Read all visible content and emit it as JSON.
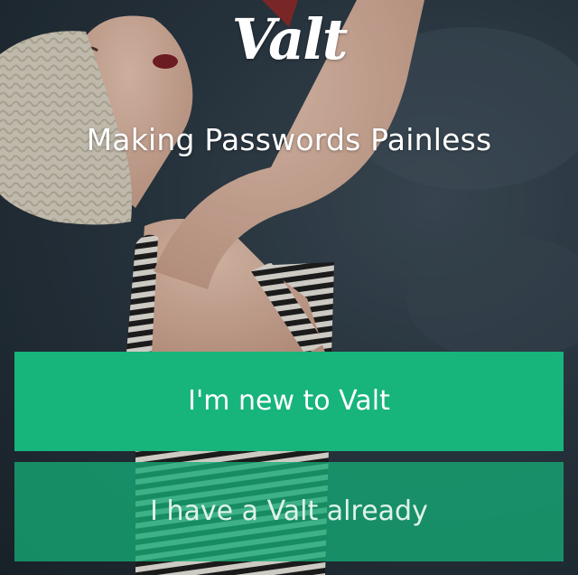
{
  "app": {
    "logo": "Valt",
    "tagline": "Making Passwords Painless"
  },
  "actions": {
    "new_user_label": "I'm new to Valt",
    "existing_user_label": "I have a Valt already"
  },
  "colors": {
    "primary_button": "#17b47c",
    "secondary_button": "#16aa76",
    "text": "#ffffff"
  },
  "background": {
    "icon": "photo-background"
  }
}
